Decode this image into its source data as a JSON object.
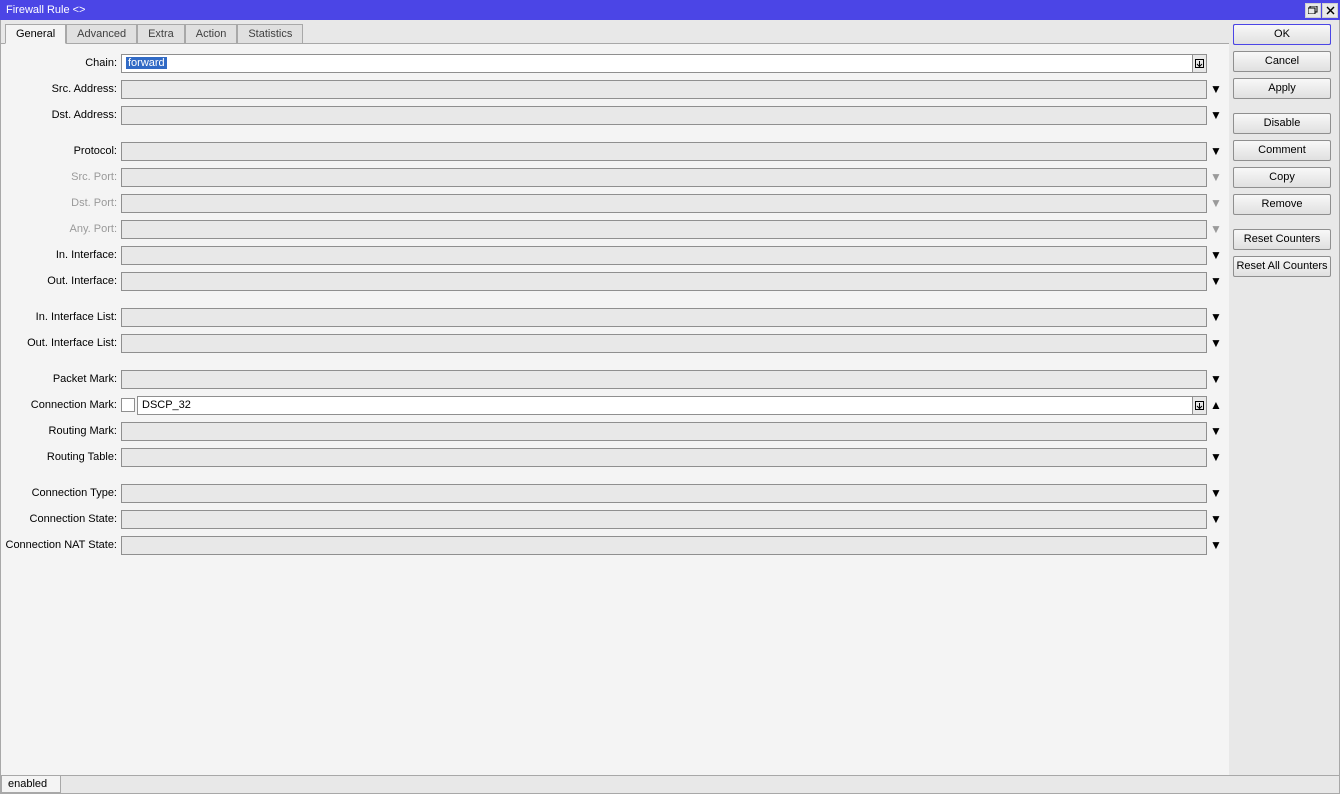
{
  "window": {
    "title": "Firewall Rule <>"
  },
  "tabs": [
    {
      "label": "General",
      "active": true
    },
    {
      "label": "Advanced",
      "active": false
    },
    {
      "label": "Extra",
      "active": false
    },
    {
      "label": "Action",
      "active": false
    },
    {
      "label": "Statistics",
      "active": false
    }
  ],
  "buttons": {
    "ok": "OK",
    "cancel": "Cancel",
    "apply": "Apply",
    "disable": "Disable",
    "comment": "Comment",
    "copy": "Copy",
    "remove": "Remove",
    "resetCounters": "Reset Counters",
    "resetAll": "Reset All Counters"
  },
  "fields": {
    "chain": {
      "label": "Chain:",
      "value": "forward",
      "type": "combo-dd",
      "white": true
    },
    "srcAddress": {
      "label": "Src. Address:",
      "value": "",
      "type": "expand",
      "white": false
    },
    "dstAddress": {
      "label": "Dst. Address:",
      "value": "",
      "type": "expand",
      "white": false
    },
    "protocol": {
      "label": "Protocol:",
      "value": "",
      "type": "expand",
      "white": false
    },
    "srcPort": {
      "label": "Src. Port:",
      "value": "",
      "type": "expand",
      "white": false,
      "disabled": true
    },
    "dstPort": {
      "label": "Dst. Port:",
      "value": "",
      "type": "expand",
      "white": false,
      "disabled": true
    },
    "anyPort": {
      "label": "Any. Port:",
      "value": "",
      "type": "expand",
      "white": false,
      "disabled": true
    },
    "inInterface": {
      "label": "In. Interface:",
      "value": "",
      "type": "expand",
      "white": false
    },
    "outInterface": {
      "label": "Out. Interface:",
      "value": "",
      "type": "expand",
      "white": false
    },
    "inInterfaceList": {
      "label": "In. Interface List:",
      "value": "",
      "type": "expand",
      "white": false
    },
    "outInterfaceList": {
      "label": "Out. Interface List:",
      "value": "",
      "type": "expand",
      "white": false
    },
    "packetMark": {
      "label": "Packet Mark:",
      "value": "",
      "type": "expand",
      "white": false
    },
    "connectionMark": {
      "label": "Connection Mark:",
      "value": "DSCP_32",
      "type": "checkbox-combo-collapse",
      "white": true
    },
    "routingMark": {
      "label": "Routing Mark:",
      "value": "",
      "type": "expand",
      "white": false
    },
    "routingTable": {
      "label": "Routing Table:",
      "value": "",
      "type": "expand",
      "white": false
    },
    "connectionType": {
      "label": "Connection Type:",
      "value": "",
      "type": "expand",
      "white": false
    },
    "connectionState": {
      "label": "Connection State:",
      "value": "",
      "type": "expand",
      "white": false
    },
    "connectionNatState": {
      "label": "Connection NAT State:",
      "value": "",
      "type": "expand",
      "white": false
    }
  },
  "status": {
    "text": "enabled"
  }
}
